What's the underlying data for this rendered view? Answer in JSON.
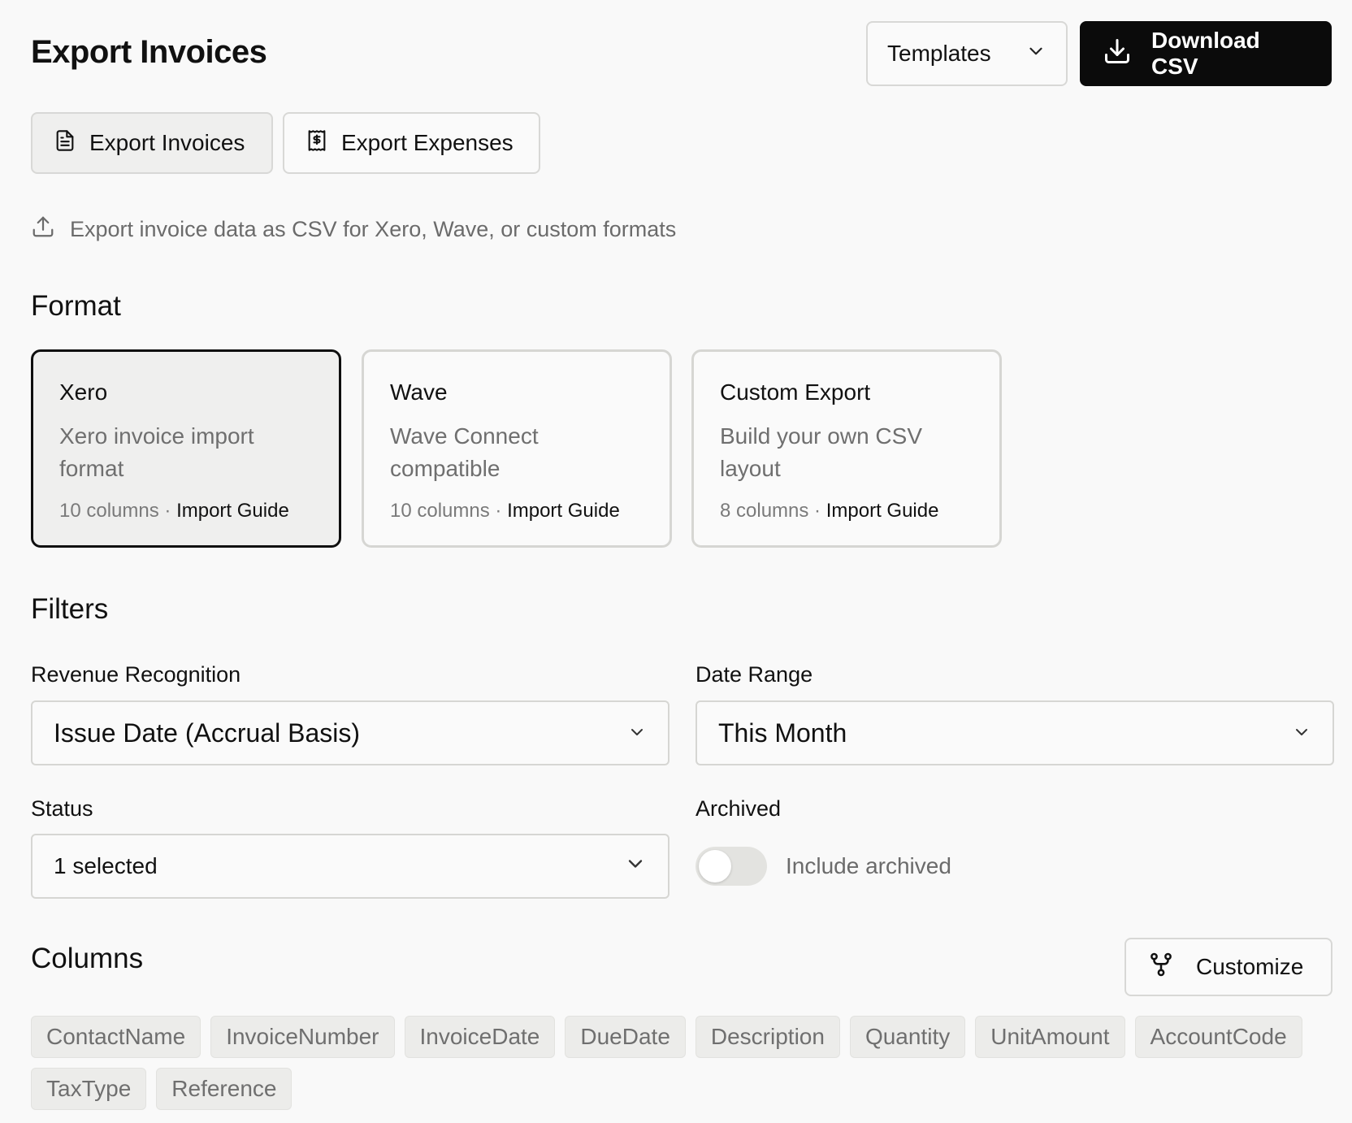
{
  "page": {
    "title": "Export Invoices"
  },
  "header": {
    "templates_label": "Templates",
    "download_label": "Download CSV"
  },
  "tabs": [
    {
      "label": "Export Invoices",
      "icon": "file-text-icon",
      "active": true
    },
    {
      "label": "Export Expenses",
      "icon": "receipt-icon",
      "active": false
    }
  ],
  "subtitle": "Export invoice data as CSV for Xero, Wave, or custom formats",
  "format": {
    "heading": "Format",
    "cards": [
      {
        "title": "Xero",
        "description": "Xero invoice import format",
        "columns": "10 columns",
        "guide": "Import Guide",
        "selected": true
      },
      {
        "title": "Wave",
        "description": "Wave Connect compatible",
        "columns": "10 columns",
        "guide": "Import Guide",
        "selected": false
      },
      {
        "title": "Custom Export",
        "description": "Build your own CSV layout",
        "columns": "8 columns",
        "guide": "Import Guide",
        "selected": false
      }
    ]
  },
  "filters": {
    "heading": "Filters",
    "revenue": {
      "label": "Revenue Recognition",
      "value": "Issue Date (Accrual Basis)"
    },
    "date_range": {
      "label": "Date Range",
      "value": "This Month"
    },
    "status": {
      "label": "Status",
      "value": "1 selected"
    },
    "archived": {
      "label": "Archived",
      "toggle_label": "Include archived",
      "on": false
    }
  },
  "columns": {
    "heading": "Columns",
    "customize_label": "Customize",
    "items": [
      "ContactName",
      "InvoiceNumber",
      "InvoiceDate",
      "DueDate",
      "Description",
      "Quantity",
      "UnitAmount",
      "AccountCode",
      "TaxType",
      "Reference"
    ]
  },
  "colors": {
    "primary": "#0b0b0b",
    "muted_text": "#6f6f6f",
    "border": "#d6d6d3",
    "chip_bg": "#ececea"
  }
}
